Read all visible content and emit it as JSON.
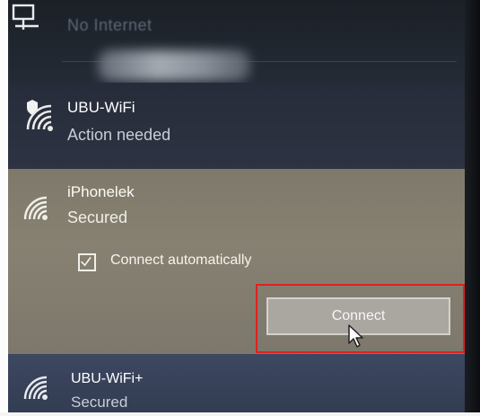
{
  "wifi_panel": {
    "networks": [
      {
        "ssid": "No Internet",
        "icon": "ethernet-pc-icon"
      },
      {
        "ssid": "UBU-WiFi",
        "status": "Action needed",
        "icon": "wifi-shield-icon"
      },
      {
        "ssid": "iPhonelek",
        "status": "Secured",
        "icon": "wifi-icon",
        "connect_automatically_label": "Connect automatically",
        "connect_automatically_checked": true,
        "connect_label": "Connect"
      },
      {
        "ssid": "UBU-WiFi+",
        "status": "Secured",
        "icon": "wifi-icon"
      }
    ]
  },
  "colors": {
    "highlight_outline": "#e02020",
    "selected_row": "#847e70",
    "panel_bg": "#1c2230"
  }
}
